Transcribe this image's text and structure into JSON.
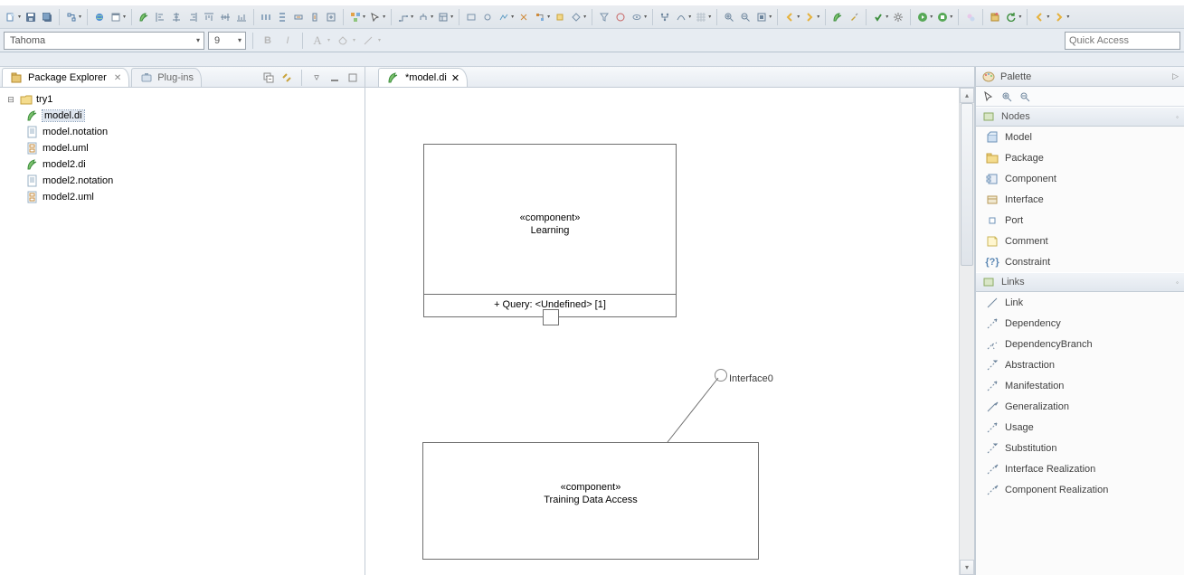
{
  "font_name": "Tahoma",
  "font_size": "9",
  "quick_access_placeholder": "Quick Access",
  "left": {
    "tab_explorer": "Package Explorer",
    "tab_plugins": "Plug-ins",
    "project": "try1",
    "files": [
      "model.di",
      "model.notation",
      "model.uml",
      "model2.di",
      "model2.notation",
      "model2.uml"
    ],
    "selected_index": 0
  },
  "editor": {
    "tab_label": "*model.di",
    "component1_stereo": "«component»",
    "component1_name": "Learning",
    "component1_attr": "+ Query: <Undefined> [1]",
    "component2_stereo": "«component»",
    "component2_name": "Training Data Access",
    "interface_label": "Interface0"
  },
  "palette": {
    "title": "Palette",
    "drawer_nodes": "Nodes",
    "nodes": [
      "Model",
      "Package",
      "Component",
      "Interface",
      "Port",
      "Comment",
      "Constraint"
    ],
    "drawer_links": "Links",
    "links": [
      "Link",
      "Dependency",
      "DependencyBranch",
      "Abstraction",
      "Manifestation",
      "Generalization",
      "Usage",
      "Substitution",
      "Interface Realization",
      "Component Realization"
    ]
  }
}
